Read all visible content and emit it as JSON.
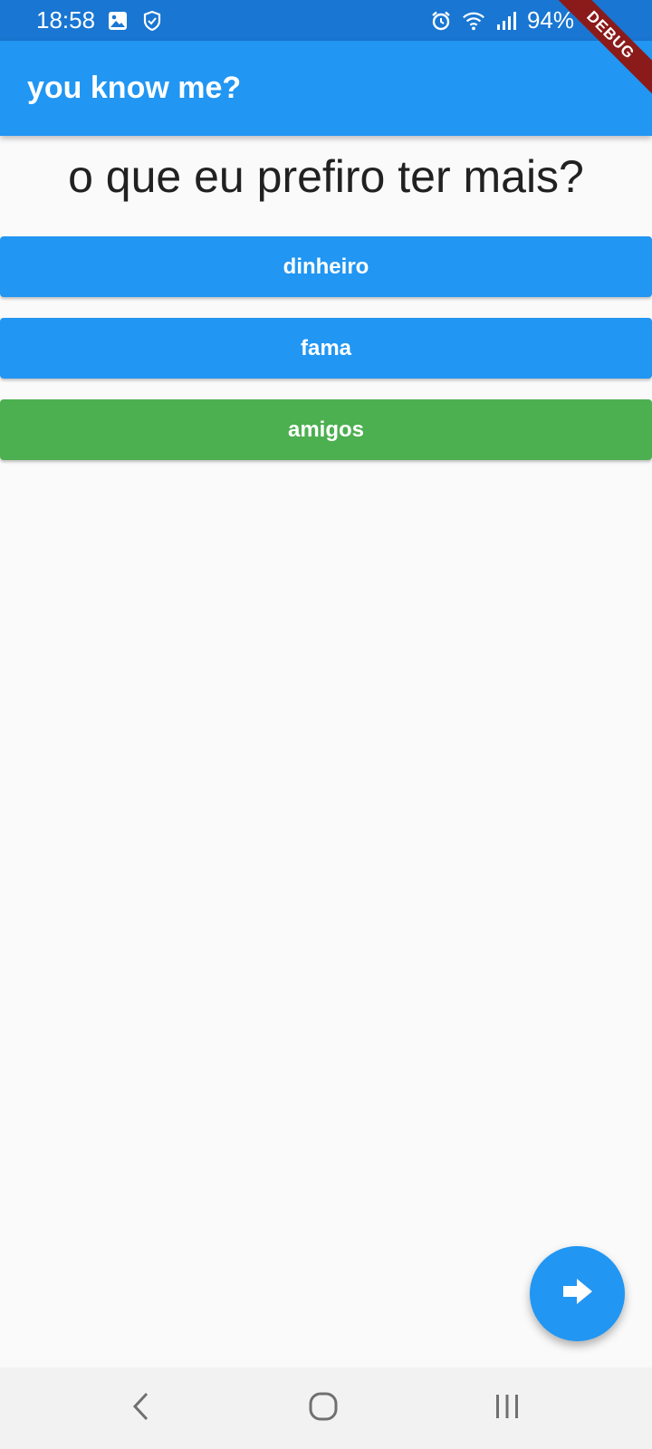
{
  "status_bar": {
    "time": "18:58",
    "battery": "94%",
    "icons": [
      "image-icon",
      "shield-icon",
      "alarm-icon",
      "wifi-icon",
      "signal-icon",
      "battery-charging-icon"
    ]
  },
  "debug_banner": "DEBUG",
  "app_bar": {
    "title": "you know me?"
  },
  "question": "o que eu prefiro ter mais?",
  "answers": [
    {
      "label": "dinheiro",
      "color": "#2196f3"
    },
    {
      "label": "fama",
      "color": "#2196f3"
    },
    {
      "label": "amigos",
      "color": "#4caf50"
    }
  ],
  "fab": {
    "icon": "arrow-right-icon"
  },
  "nav_bar": {
    "icons": [
      "back-icon",
      "home-icon",
      "recents-icon"
    ]
  },
  "colors": {
    "primary": "#2196f3",
    "primary_dark": "#1976d2",
    "correct": "#4caf50",
    "background": "#fafafa"
  }
}
